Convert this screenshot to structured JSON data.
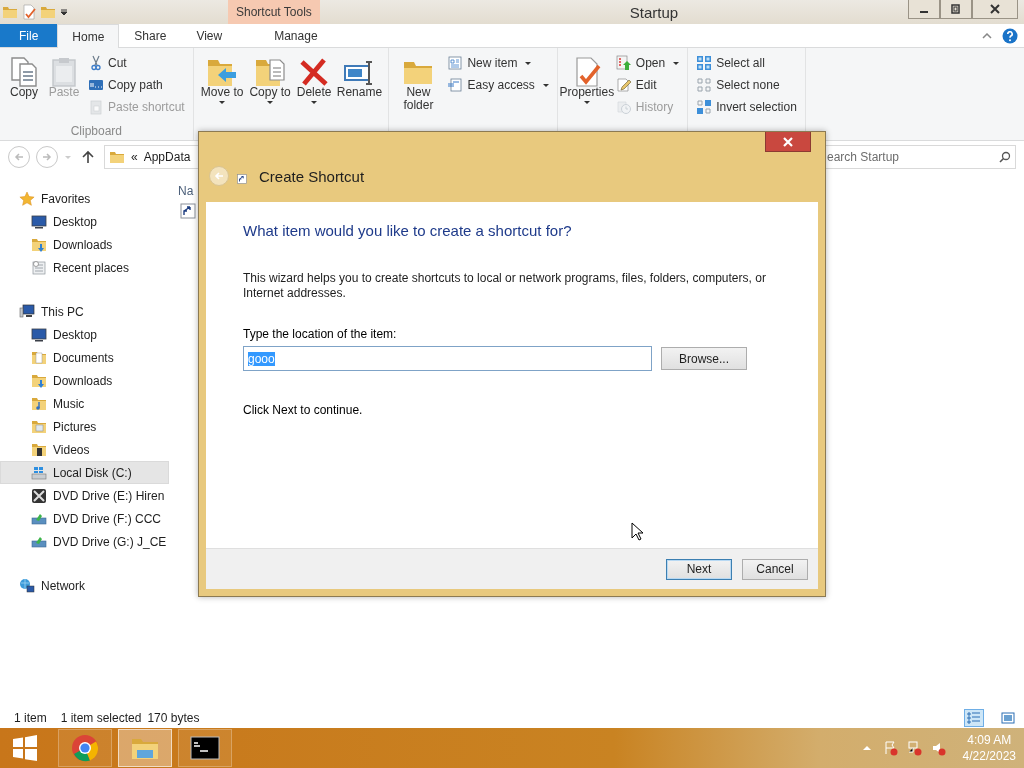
{
  "window": {
    "title": "Startup",
    "contextual_group": "Shortcut Tools"
  },
  "ribbon_tabs": [
    {
      "label": "File",
      "kind": "file",
      "selected": false
    },
    {
      "label": "Home",
      "kind": "tab",
      "selected": true
    },
    {
      "label": "Share",
      "kind": "tab",
      "selected": false
    },
    {
      "label": "View",
      "kind": "tab",
      "selected": false
    },
    {
      "label": "Manage",
      "kind": "contextual",
      "selected": false
    }
  ],
  "ribbon_groups": [
    {
      "label": "Clipboard",
      "commands": [
        {
          "label": "Copy",
          "kind": "large",
          "dropdown": false,
          "disabled": false
        },
        {
          "label": "Paste",
          "kind": "large",
          "dropdown": false,
          "disabled": true
        },
        {
          "label": "Cut",
          "kind": "small",
          "dropdown": false,
          "disabled": false
        },
        {
          "label": "Copy path",
          "kind": "small",
          "dropdown": false,
          "disabled": false
        },
        {
          "label": "Paste shortcut",
          "kind": "small",
          "dropdown": false,
          "disabled": true
        }
      ]
    },
    {
      "commands": [
        {
          "label": "Move to",
          "kind": "large",
          "dropdown": true,
          "disabled": false
        },
        {
          "label": "Copy to",
          "kind": "large",
          "dropdown": true,
          "disabled": false
        },
        {
          "label": "Delete",
          "kind": "large",
          "dropdown": true,
          "disabled": false
        },
        {
          "label": "Rename",
          "kind": "large",
          "dropdown": false,
          "disabled": false
        }
      ]
    },
    {
      "commands": [
        {
          "label": "New folder",
          "kind": "large",
          "dropdown": false,
          "disabled": false
        },
        {
          "label": "New item",
          "kind": "small",
          "dropdown": true,
          "disabled": false
        },
        {
          "label": "Easy access",
          "kind": "small",
          "dropdown": true,
          "disabled": false
        }
      ]
    },
    {
      "commands": [
        {
          "label": "Properties",
          "kind": "large",
          "dropdown": true,
          "disabled": false
        },
        {
          "label": "Open",
          "kind": "small",
          "dropdown": true,
          "disabled": false
        },
        {
          "label": "Edit",
          "kind": "small",
          "dropdown": false,
          "disabled": false
        },
        {
          "label": "History",
          "kind": "small",
          "dropdown": false,
          "disabled": true
        }
      ]
    },
    {
      "commands": [
        {
          "label": "Select all",
          "kind": "small",
          "dropdown": false,
          "disabled": false
        },
        {
          "label": "Select none",
          "kind": "small",
          "dropdown": false,
          "disabled": false
        },
        {
          "label": "Invert selection",
          "kind": "small",
          "dropdown": false,
          "disabled": false
        }
      ]
    }
  ],
  "address_bar": {
    "separator": "«",
    "path": "AppData"
  },
  "search": {
    "placeholder": "earch Startup"
  },
  "navigation": [
    {
      "label": "Favorites",
      "selected": false,
      "children": [
        {
          "label": "Desktop",
          "selected": false
        },
        {
          "label": "Downloads",
          "selected": false
        },
        {
          "label": "Recent places",
          "selected": false
        }
      ]
    },
    {
      "label": "This PC",
      "selected": false,
      "children": [
        {
          "label": "Desktop",
          "selected": false
        },
        {
          "label": "Documents",
          "selected": false
        },
        {
          "label": "Downloads",
          "selected": false
        },
        {
          "label": "Music",
          "selected": false
        },
        {
          "label": "Pictures",
          "selected": false
        },
        {
          "label": "Videos",
          "selected": false
        },
        {
          "label": "Local Disk (C:)",
          "selected": true
        },
        {
          "label": "DVD Drive (E:) Hiren",
          "selected": false
        },
        {
          "label": "DVD Drive (F:) CCC",
          "selected": false
        },
        {
          "label": "DVD Drive (G:) J_CE",
          "selected": false
        }
      ]
    },
    {
      "label": "Network",
      "selected": false
    }
  ],
  "file_list": {
    "column_1": "Na"
  },
  "status_bar": {
    "item_count": "1 item",
    "selection": "1 item selected",
    "size": "170 bytes",
    "views": [
      {
        "selected": true
      },
      {
        "selected": false
      }
    ]
  },
  "dialog": {
    "title": "Create Shortcut",
    "heading": "What item would you like to create a shortcut for?",
    "description": "This wizard helps you to create shortcuts to local or network programs, files, folders, computers, or Internet addresses.",
    "field_label": "Type the location of the item:",
    "field_value": "gooo",
    "value_selected": true,
    "hint": "Click Next to continue.",
    "buttons": [
      {
        "label": "Browse...",
        "kind": "browse",
        "default": false
      },
      {
        "label": "Next",
        "kind": "footer",
        "default": true
      },
      {
        "label": "Cancel",
        "kind": "footer",
        "default": false
      }
    ]
  },
  "taskbar": {
    "apps": [
      {
        "selected": false
      },
      {
        "selected": true
      },
      {
        "selected": false
      }
    ],
    "time": "4:09 AM",
    "date": "4/22/2023"
  }
}
